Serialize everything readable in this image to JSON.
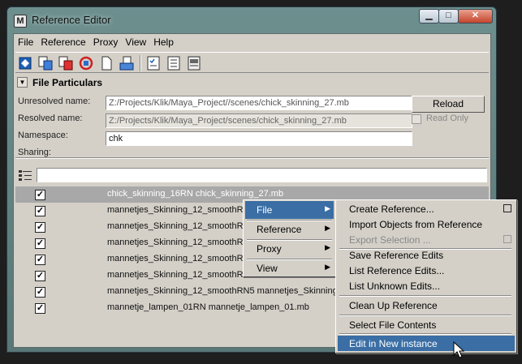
{
  "window": {
    "title": "Reference Editor",
    "icon": "maya-app-icon",
    "controls": [
      "minimize",
      "maximize",
      "close"
    ]
  },
  "menubar": [
    "File",
    "Reference",
    "Proxy",
    "View",
    "Help"
  ],
  "toolbar": {
    "icons": [
      "reload-reference-icon",
      "create-reference-icon",
      "import-reference-icon",
      "replace-reference-icon",
      "new-file-icon",
      "proxy-icon",
      "list-edits-icon",
      "list-unknown-edits-icon",
      "file-info-icon"
    ]
  },
  "file_particulars": {
    "header": "File Particulars",
    "unresolved_label": "Unresolved name:",
    "unresolved_value": "Z:/Projects/Klik/Maya_Project//scenes/chick_skinning_27.mb",
    "resolved_label": "Resolved name:",
    "resolved_value": "Z:/Projects/Klik/Maya_Project/scenes/chick_skinning_27.mb",
    "namespace_label": "Namespace:",
    "namespace_value": "chk",
    "sharing_label": "Sharing:",
    "reload_label": "Reload",
    "readonly_label": "Read Only"
  },
  "references": [
    {
      "checked": true,
      "name": "chick_skinning_16RN chick_skinning_27.mb",
      "selected": true
    },
    {
      "checked": true,
      "name": "mannetjes_Skinning_12_smoothRN"
    },
    {
      "checked": true,
      "name": "mannetjes_Skinning_12_smoothRN"
    },
    {
      "checked": true,
      "name": "mannetjes_Skinning_12_smoothRN"
    },
    {
      "checked": true,
      "name": "mannetjes_Skinning_12_smoothRN"
    },
    {
      "checked": true,
      "name": "mannetjes_Skinning_12_smoothRN"
    },
    {
      "checked": true,
      "name": "mannetjes_Skinning_12_smoothRN5 mannetjes_Skinning_1"
    },
    {
      "checked": true,
      "name": "mannetje_lampen_01RN mannetje_lampen_01.mb"
    }
  ],
  "context_menu": {
    "items": [
      {
        "label": "File",
        "active": true
      },
      {
        "label": "Reference"
      },
      {
        "label": "Proxy"
      },
      {
        "label": "View"
      }
    ]
  },
  "file_submenu": {
    "items": [
      {
        "label": "Create Reference...",
        "option_box": true
      },
      {
        "label": "Import Objects from Reference"
      },
      {
        "label": "Export Selection ...",
        "disabled": true,
        "option_box": true
      },
      {
        "label": "Save Reference Edits"
      },
      {
        "label": "List Reference Edits..."
      },
      {
        "label": "List Unknown Edits..."
      },
      {
        "label": "Clean Up Reference"
      },
      {
        "label": "Select File Contents"
      },
      {
        "label": "Edit in New instance",
        "active": true
      }
    ]
  },
  "colors": {
    "titlebar": "#6d8f8e",
    "panel": "#d4d0c8",
    "selection": "#3a6ea5",
    "row_selected": "#a8a8a8"
  }
}
